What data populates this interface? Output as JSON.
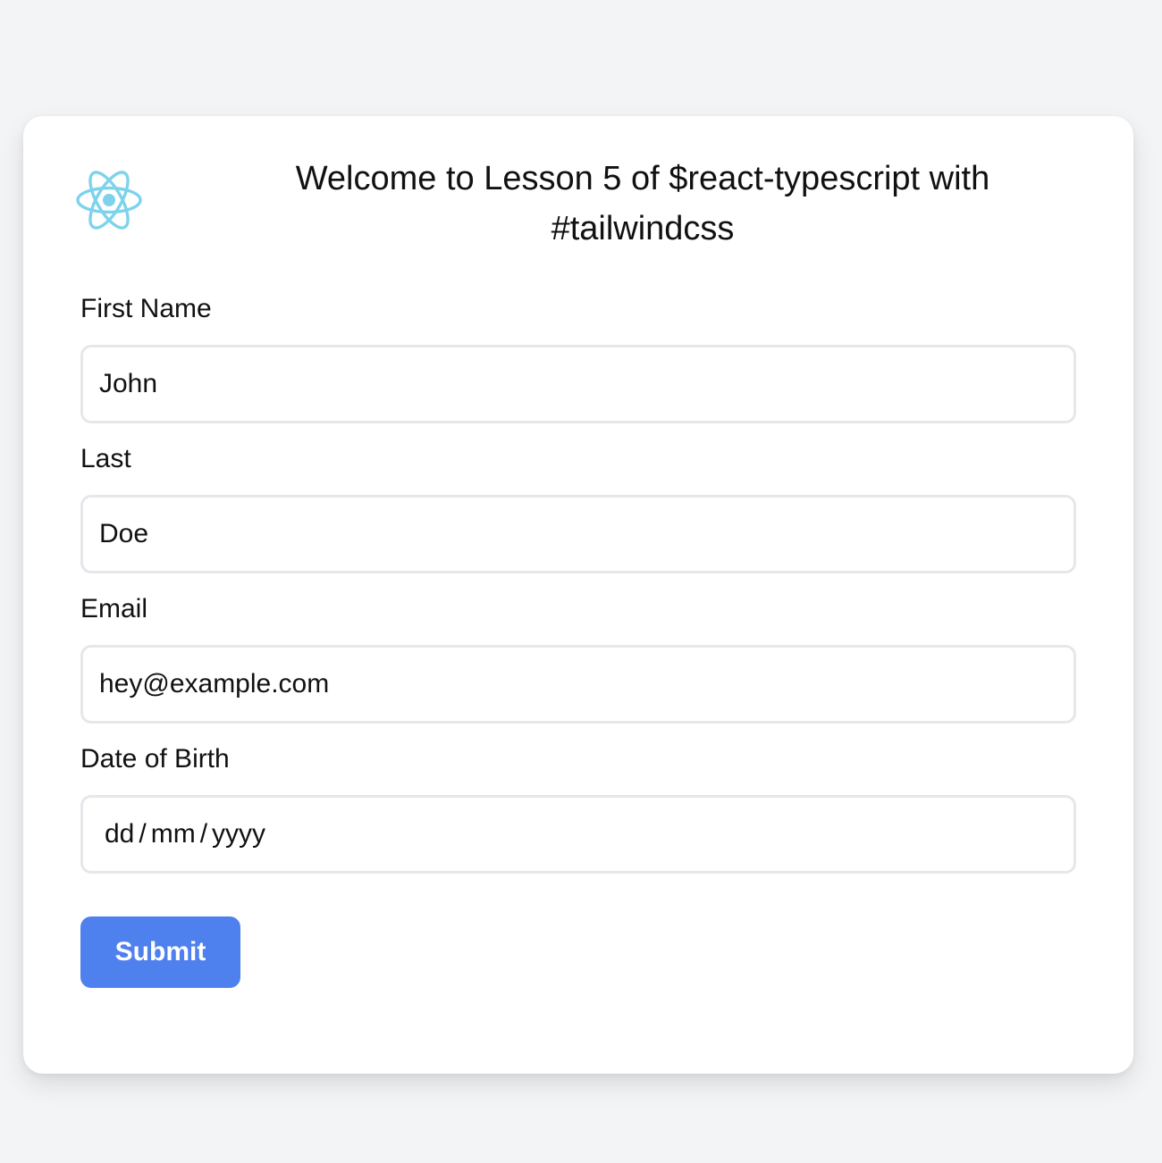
{
  "header": {
    "logo_icon": "react-atom-icon",
    "logo_color": "#7dd3ec",
    "title": "Welcome to Lesson 5 of $react-typescript with #tailwindcss"
  },
  "form": {
    "first_name": {
      "label": "First Name",
      "value": "John"
    },
    "last_name": {
      "label": "Last",
      "value": "Doe"
    },
    "email": {
      "label": "Email",
      "value": "hey@example.com"
    },
    "dob": {
      "label": "Date of Birth",
      "day": "dd",
      "month": "mm",
      "year": "yyyy",
      "separator": "/"
    },
    "submit_label": "Submit"
  },
  "colors": {
    "page_background": "#f3f4f6",
    "card_background": "#ffffff",
    "input_border": "#e5e7eb",
    "button_background": "#4f81ee",
    "button_text": "#ffffff"
  }
}
